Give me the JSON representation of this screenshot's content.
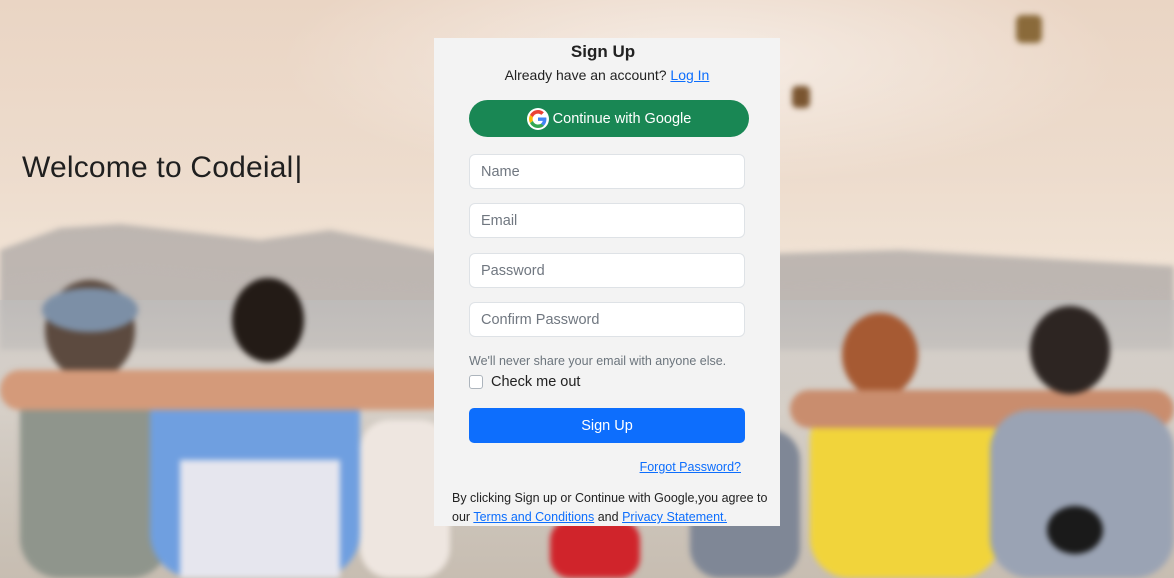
{
  "hero": {
    "welcome_text": "Welcome to Codeial",
    "cursor": "|"
  },
  "signup": {
    "title": "Sign Up",
    "login_prompt": "Already have an account?",
    "login_link": "Log In",
    "google_button": "Continue with Google",
    "fields": {
      "name_placeholder": "Name",
      "email_placeholder": "Email",
      "password_placeholder": "Password",
      "confirm_password_placeholder": "Confirm Password"
    },
    "help_text": "We'll never share your email with anyone else.",
    "check_label": "Check me out",
    "submit_button": "Sign Up",
    "forgot_link": "Forgot Password?",
    "terms_prefix": "By clicking Sign up or Continue with Google,you agree to our",
    "terms_link": "Terms and Conditions",
    "terms_and": "and",
    "privacy_link": "Privacy Statement."
  },
  "colors": {
    "google_button": "#198754",
    "primary_button": "#0d6efd",
    "link": "#0d6efd",
    "card_background": "#f3f3f3"
  },
  "icons": {
    "google": "google-icon"
  }
}
